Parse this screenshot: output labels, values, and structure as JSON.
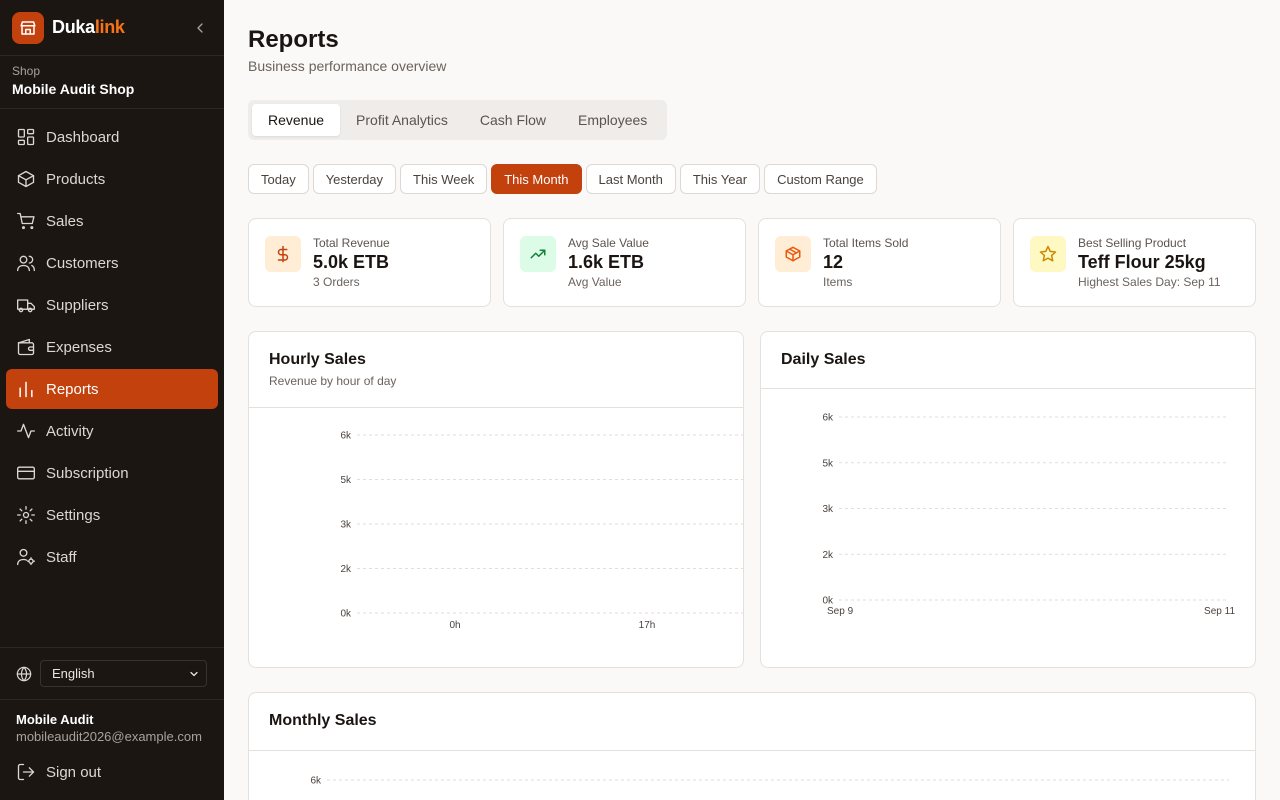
{
  "brand": {
    "name_part1": "Duka",
    "name_part2": "link"
  },
  "shop": {
    "label": "Shop",
    "name": "Mobile Audit Shop"
  },
  "nav": [
    {
      "label": "Dashboard",
      "icon": "dashboard-icon"
    },
    {
      "label": "Products",
      "icon": "box-icon"
    },
    {
      "label": "Sales",
      "icon": "cart-icon"
    },
    {
      "label": "Customers",
      "icon": "users-icon"
    },
    {
      "label": "Suppliers",
      "icon": "truck-icon"
    },
    {
      "label": "Expenses",
      "icon": "wallet-icon"
    },
    {
      "label": "Reports",
      "icon": "bar-chart-icon",
      "active": true
    },
    {
      "label": "Activity",
      "icon": "activity-icon"
    },
    {
      "label": "Subscription",
      "icon": "credit-card-icon"
    },
    {
      "label": "Settings",
      "icon": "gear-icon"
    },
    {
      "label": "Staff",
      "icon": "user-cog-icon"
    }
  ],
  "language": {
    "selected": "English"
  },
  "user": {
    "name": "Mobile Audit",
    "email": "mobileaudit2026@example.com"
  },
  "signout_label": "Sign out",
  "page": {
    "title": "Reports",
    "subtitle": "Business performance overview"
  },
  "tabs": [
    {
      "label": "Revenue",
      "active": true
    },
    {
      "label": "Profit Analytics"
    },
    {
      "label": "Cash Flow"
    },
    {
      "label": "Employees"
    }
  ],
  "ranges": [
    {
      "label": "Today"
    },
    {
      "label": "Yesterday"
    },
    {
      "label": "This Week"
    },
    {
      "label": "This Month",
      "active": true
    },
    {
      "label": "Last Month"
    },
    {
      "label": "This Year"
    },
    {
      "label": "Custom Range"
    }
  ],
  "stats": [
    {
      "label": "Total Revenue",
      "value": "5.0k ETB",
      "sub": "3 Orders",
      "icon": "dollar-icon",
      "bg": "#ffedd5",
      "fg": "#c2410c"
    },
    {
      "label": "Avg Sale Value",
      "value": "1.6k ETB",
      "sub": "Avg Value",
      "icon": "trending-up-icon",
      "bg": "#dcfce7",
      "fg": "#15803d"
    },
    {
      "label": "Total Items Sold",
      "value": "12",
      "sub": "Items",
      "icon": "package-icon",
      "bg": "#ffedd5",
      "fg": "#ea580c"
    },
    {
      "label": "Best Selling Product",
      "value": "Teff Flour 25kg",
      "sub": "Highest Sales Day: Sep 11",
      "icon": "star-icon",
      "bg": "#fef9c3",
      "fg": "#ca8a04"
    }
  ],
  "colors": {
    "accent": "#c2410c",
    "sidebar_bg": "#1c1613",
    "page_bg": "#faf9f7"
  },
  "charts": {
    "hourly": {
      "title": "Hourly Sales",
      "subtitle": "Revenue by hour of day"
    },
    "daily": {
      "title": "Daily Sales"
    },
    "monthly": {
      "title": "Monthly Sales"
    }
  },
  "chart_data": [
    {
      "type": "line",
      "title": "Hourly Sales",
      "subtitle": "Revenue by hour of day",
      "x_tick_labels": [
        "0h",
        "17h"
      ],
      "y_tick_labels": [
        "0k",
        "2k",
        "3k",
        "5k",
        "6k"
      ],
      "series": [],
      "grid": true
    },
    {
      "type": "line",
      "title": "Daily Sales",
      "x_tick_labels": [
        "Sep 9",
        "Sep 11"
      ],
      "y_tick_labels": [
        "0k",
        "2k",
        "3k",
        "5k",
        "6k"
      ],
      "series": [],
      "grid": true
    },
    {
      "type": "line",
      "title": "Monthly Sales",
      "x_tick_labels": [],
      "y_tick_labels": [
        "6k"
      ],
      "series": [],
      "grid": true
    }
  ]
}
